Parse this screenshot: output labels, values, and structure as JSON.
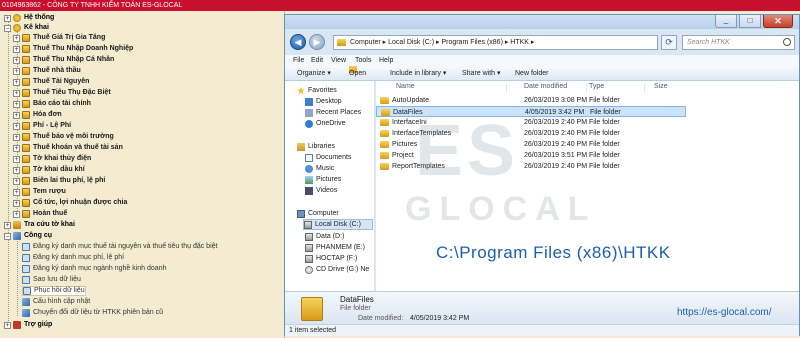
{
  "app": {
    "title": "0104963862 - CÔNG TY TNHH KIỂM TOÁN ES-GLOCAL"
  },
  "tree": {
    "he_thong": "Hệ thống",
    "ke_khai": "Kê khai",
    "items": [
      "Thuế Giá Trị Gia Tăng",
      "Thuế Thu Nhập Doanh Nghiệp",
      "Thuế Thu Nhập Cá Nhân",
      "Thuế nhà thầu",
      "Thuế Tài Nguyên",
      "Thuế Tiêu Thụ Đặc Biệt",
      "Báo cáo tài chính",
      "Hóa đơn",
      "Phí - Lệ Phí",
      "Thuế bảo vệ môi trường",
      "Thuế khoán và thuế tài sản",
      "Tờ khai thủy điện",
      "Tờ khai dầu khí",
      "Biên lai thu phí, lệ phí",
      "Tem rượu",
      "Cổ tức, lợi nhuận được chia",
      "Hoàn thuế"
    ],
    "tra_cuu": "Tra cứu tờ khai",
    "cong_cu": "Công cụ",
    "tools": [
      "Đăng ký danh mục thuế tài nguyên và thuế tiêu thụ đặc biệt",
      "Đăng ký danh mục phí, lệ phí",
      "Đăng ký danh mục ngành nghề kinh doanh",
      "Sao lưu dữ liệu",
      "Phục hồi dữ liệu",
      "Cấu hình cập nhật",
      "Chuyển đổi dữ liệu từ HTKK phiên bản cũ"
    ],
    "tro_giup": "Trợ giúp"
  },
  "explorer": {
    "address": "Computer  ▸  Local Disk (C:)  ▸  Program Files (x86)  ▸  HTKK  ▸",
    "search_placeholder": "Search HTKK",
    "menu": [
      "File",
      "Edit",
      "View",
      "Tools",
      "Help"
    ],
    "toolbar": {
      "organize": "Organize ▾",
      "open": "Open",
      "include": "Include in library ▾",
      "share": "Share with ▾",
      "new_folder": "New folder"
    },
    "columns": [
      "Name",
      "Date modified",
      "Type",
      "Size"
    ],
    "files": [
      {
        "name": "AutoUpdate",
        "date": "26/03/2019 3:08 PM",
        "type": "File folder"
      },
      {
        "name": "DataFiles",
        "date": "4/05/2019 3:42 PM",
        "type": "File folder"
      },
      {
        "name": "InterfaceIni",
        "date": "26/03/2019 2:40 PM",
        "type": "File folder"
      },
      {
        "name": "InterfaceTemplates",
        "date": "26/03/2019 2:40 PM",
        "type": "File folder"
      },
      {
        "name": "Pictures",
        "date": "26/03/2019 2:40 PM",
        "type": "File folder"
      },
      {
        "name": "Project",
        "date": "26/03/2019 3:51 PM",
        "type": "File folder"
      },
      {
        "name": "ReportTemplates",
        "date": "26/03/2019 2:40 PM",
        "type": "File folder"
      }
    ],
    "nav": {
      "favorites": "Favorites",
      "desktop": "Desktop",
      "recent": "Recent Places",
      "onedrive": "OneDrive",
      "libraries": "Libraries",
      "documents": "Documents",
      "music": "Music",
      "pictures": "Pictures",
      "videos": "Videos",
      "computer": "Computer",
      "local_c": "Local Disk (C:)",
      "data_d": "Data (D:)",
      "phanmem_e": "PHANMEM (E:)",
      "hoctap_f": "HOCTAP (F:)",
      "cd_g": "CD Drive (G:) Ne"
    },
    "details": {
      "name": "DataFiles",
      "type": "File folder",
      "modified_label": "Date modified:",
      "modified_value": "4/05/2019 3:42 PM"
    },
    "status": "1 item selected"
  },
  "overlay": {
    "path_caption": "C:\\Program Files (x86)\\HTKK",
    "url": "https://es-glocal.com/",
    "watermark_es": "ES",
    "watermark_glocal": "GLOCAL"
  },
  "colors": {
    "titlebar": "#c8102e",
    "tree_bg": "#f3ecd1",
    "accent_blue": "#1c5fae"
  }
}
